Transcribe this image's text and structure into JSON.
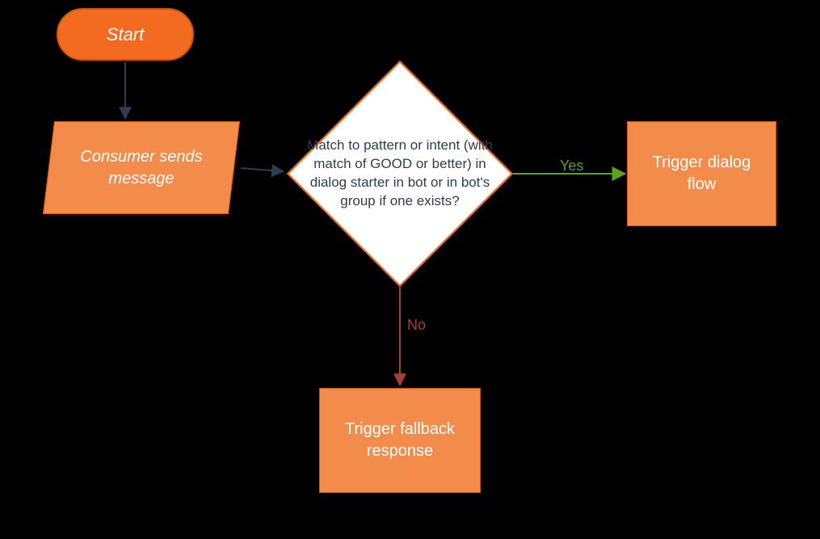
{
  "nodes": {
    "start": {
      "label": "Start"
    },
    "input": {
      "label": "Consumer sends message"
    },
    "decision": {
      "label": "Match to pattern\nor intent (with match of GOOD or better)\nin dialog starter in bot or in bot's group\nif one exists?"
    },
    "dialog_flow": {
      "label": "Trigger dialog flow"
    },
    "fallback": {
      "label": "Trigger fallback response"
    }
  },
  "edges": {
    "yes": {
      "label": "Yes"
    },
    "no": {
      "label": "No"
    }
  },
  "colors": {
    "orange_fill": "#f38b4a",
    "orange_dark": "#f26b21",
    "yes_arrow": "#5fa020",
    "no_arrow": "#a93b3b",
    "decision_text": "#2c3e50"
  }
}
